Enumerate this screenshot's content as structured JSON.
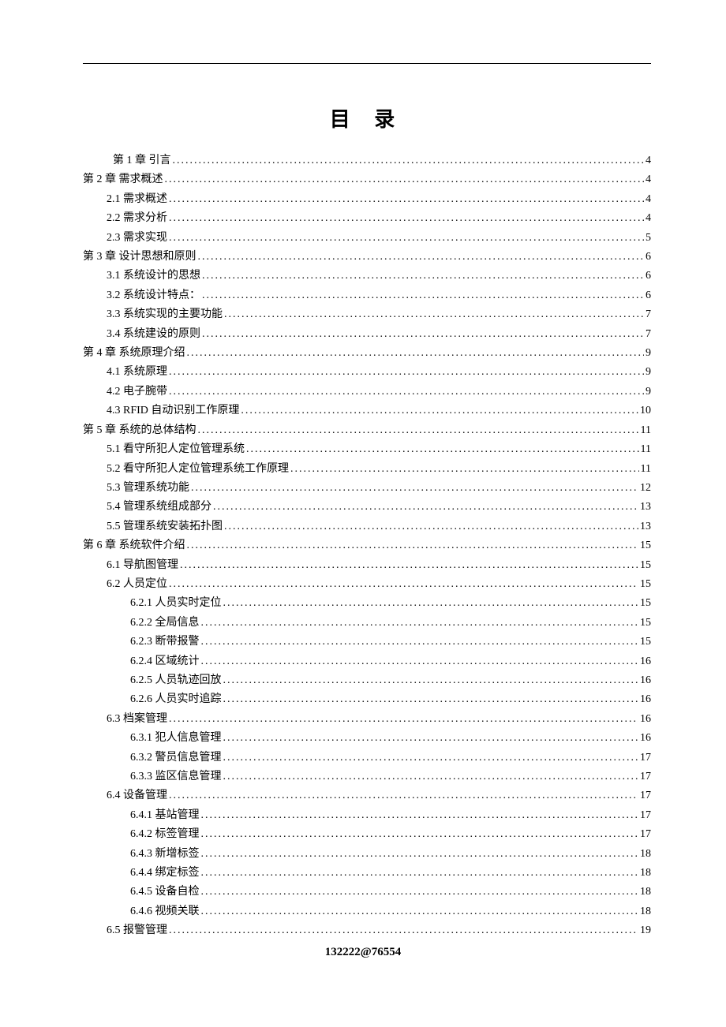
{
  "title": "目 录",
  "footer": "132222@76554",
  "entries": [
    {
      "indent": "special",
      "label": "第 1 章  引言",
      "page": "4"
    },
    {
      "indent": 0,
      "label": "第 2 章  需求概述",
      "page": "4"
    },
    {
      "indent": 1,
      "label": "2.1  需求概述",
      "page": "4"
    },
    {
      "indent": 1,
      "label": "2.2  需求分析",
      "page": "4"
    },
    {
      "indent": 1,
      "label": "2.3  需求实现",
      "page": "5"
    },
    {
      "indent": 0,
      "label": "第 3 章   设计思想和原则",
      "page": "6"
    },
    {
      "indent": 1,
      "label": "3.1  系统设计的思想",
      "page": "6"
    },
    {
      "indent": 1,
      "label": "3.2  系统设计特点：",
      "page": "6"
    },
    {
      "indent": 1,
      "label": "3.3  系统实现的主要功能",
      "page": "7"
    },
    {
      "indent": 1,
      "label": "3.4  系统建设的原则",
      "page": "7"
    },
    {
      "indent": 0,
      "label": "第 4 章  系统原理介绍",
      "page": "9"
    },
    {
      "indent": 1,
      "label": "4.1  系统原理",
      "page": "9"
    },
    {
      "indent": 1,
      "label": "4.2  电子腕带",
      "page": "9"
    },
    {
      "indent": 1,
      "label": "4.3  RFID 自动识别工作原理",
      "page": "10"
    },
    {
      "indent": 0,
      "label": "第 5 章  系统的总体结构",
      "page": "11"
    },
    {
      "indent": 1,
      "label": "5.1  看守所犯人定位管理系统",
      "page": "11"
    },
    {
      "indent": 1,
      "label": "5.2  看守所犯人定位管理系统工作原理",
      "page": "11"
    },
    {
      "indent": 1,
      "label": "5.3  管理系统功能",
      "page": "12"
    },
    {
      "indent": 1,
      "label": "5.4  管理系统组成部分",
      "page": "13"
    },
    {
      "indent": 1,
      "label": "5.5  管理系统安装拓扑图",
      "page": "13"
    },
    {
      "indent": 0,
      "label": "第 6 章  系统软件介绍",
      "page": "15"
    },
    {
      "indent": 1,
      "label": "6.1   导航图管理",
      "page": "15"
    },
    {
      "indent": 1,
      "label": "6.2  人员定位",
      "page": "15"
    },
    {
      "indent": 2,
      "label": "6.2.1  人员实时定位",
      "page": "15"
    },
    {
      "indent": 2,
      "label": "6.2.2  全局信息",
      "page": "15"
    },
    {
      "indent": 2,
      "label": "6.2.3  断带报警",
      "page": "15"
    },
    {
      "indent": 2,
      "label": "6.2.4  区域统计",
      "page": "16"
    },
    {
      "indent": 2,
      "label": "6.2.5  人员轨迹回放",
      "page": "16"
    },
    {
      "indent": 2,
      "label": "6.2.6  人员实时追踪",
      "page": "16"
    },
    {
      "indent": 1,
      "label": "6.3  档案管理",
      "page": "16"
    },
    {
      "indent": 2,
      "label": "6.3.1  犯人信息管理",
      "page": "16"
    },
    {
      "indent": 2,
      "label": "6.3.2  警员信息管理",
      "page": "17"
    },
    {
      "indent": 2,
      "label": "6.3.3  监区信息管理",
      "page": "17"
    },
    {
      "indent": 1,
      "label": "6.4  设备管理",
      "page": "17"
    },
    {
      "indent": 2,
      "label": "6.4.1  基站管理",
      "page": "17"
    },
    {
      "indent": 2,
      "label": "6.4.2  标签管理",
      "page": "17"
    },
    {
      "indent": 2,
      "label": "6.4.3  新增标签",
      "page": "18"
    },
    {
      "indent": 2,
      "label": "6.4.4  绑定标签",
      "page": "18"
    },
    {
      "indent": 2,
      "label": "6.4.5  设备自检",
      "page": "18"
    },
    {
      "indent": 2,
      "label": "6.4.6  视频关联",
      "page": "18"
    },
    {
      "indent": 1,
      "label": "6.5  报警管理",
      "page": "19"
    }
  ]
}
